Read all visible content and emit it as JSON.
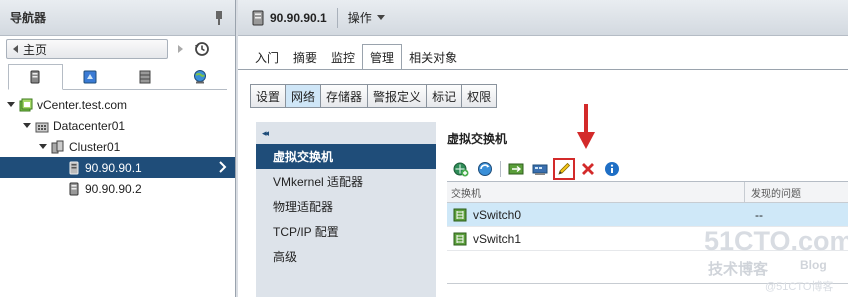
{
  "navigator": {
    "title": "导航器",
    "home_label": "主页",
    "tree": [
      {
        "label": "vCenter.test.com"
      },
      {
        "label": "Datacenter01"
      },
      {
        "label": "Cluster01"
      },
      {
        "label": "90.90.90.1"
      },
      {
        "label": "90.90.90.2"
      }
    ]
  },
  "header": {
    "object_title": "90.90.90.1",
    "actions_label": "操作"
  },
  "tabs": [
    "入门",
    "摘要",
    "监控",
    "管理",
    "相关对象"
  ],
  "subtabs": [
    "设置",
    "网络",
    "存储器",
    "警报定义",
    "标记",
    "权限"
  ],
  "sidemenu": {
    "collapse_glyph": "◂◂",
    "items": [
      "虚拟交换机",
      "VMkernel 适配器",
      "物理适配器",
      "TCP/IP 配置",
      "高级"
    ]
  },
  "content": {
    "title": "虚拟交换机",
    "columns": [
      "交换机",
      "发现的问题"
    ],
    "rows": [
      {
        "name": "vSwitch0",
        "issue": "--"
      },
      {
        "name": "vSwitch1",
        "issue": ""
      }
    ]
  },
  "watermark": {
    "main": "51CTO.com",
    "sub": "技术博客",
    "blog": "Blog",
    "signature": "@51CTO博客"
  },
  "colors": {
    "selection": "#1f4d79",
    "row_highlight": "#cfe8f8",
    "annotation_red": "#d32a2a"
  }
}
